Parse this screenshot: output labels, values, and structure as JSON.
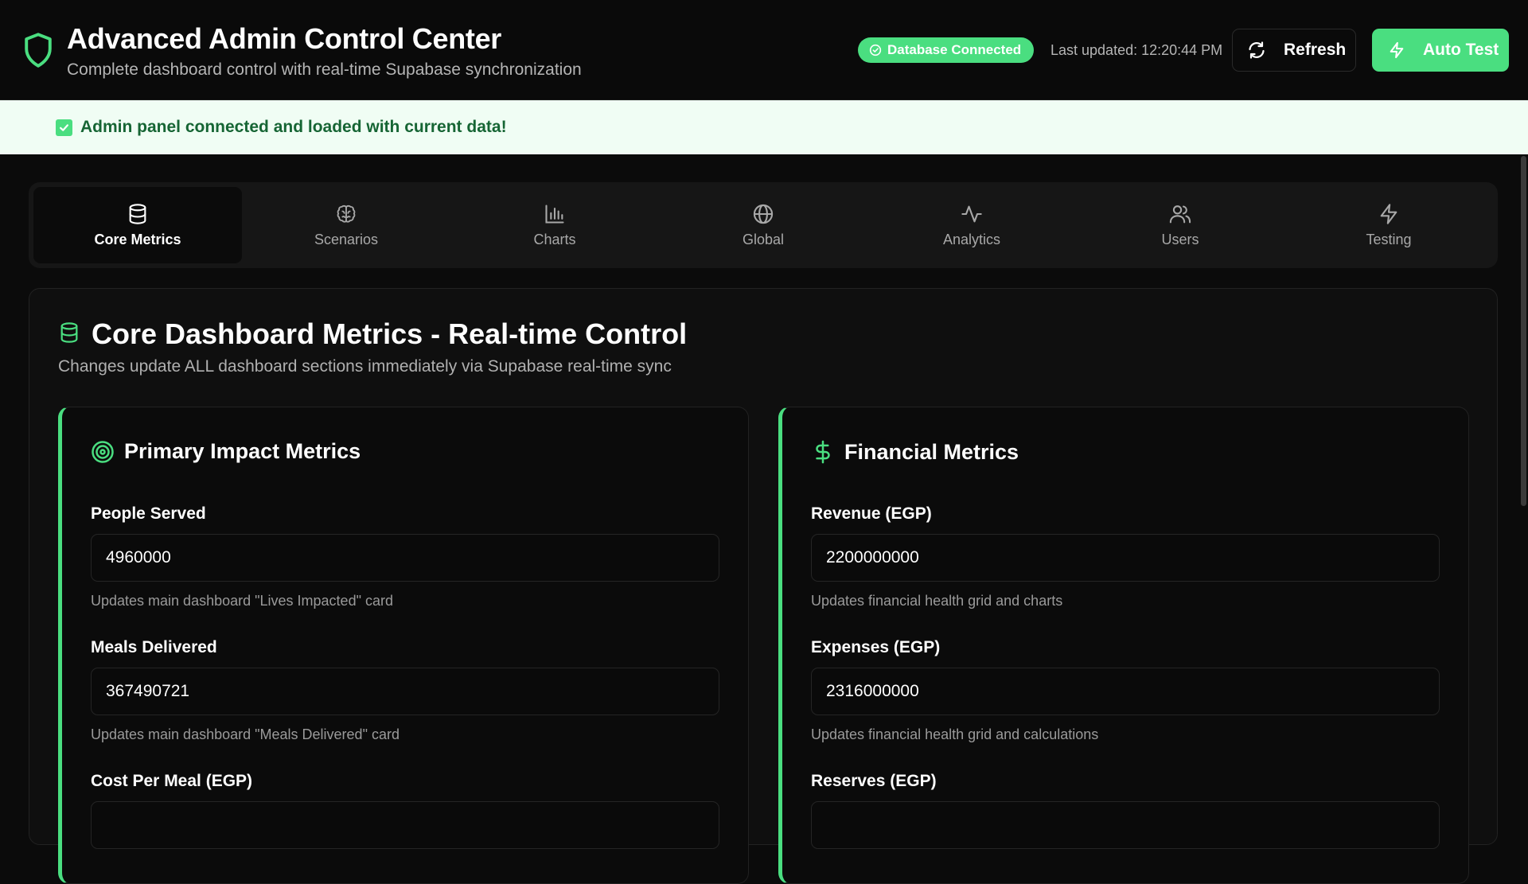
{
  "header": {
    "title": "Advanced Admin Control Center",
    "subtitle": "Complete dashboard control with real-time Supabase synchronization",
    "db_status": "Database Connected",
    "last_updated": "Last updated: 12:20:44 PM",
    "refresh_label": "Refresh",
    "autotest_label": "Auto Test",
    "brand_icon": "shield-icon"
  },
  "notice": {
    "text": "Admin panel connected and loaded with current data!",
    "icon": "check-square-icon"
  },
  "tabs": [
    {
      "label": "Core Metrics",
      "icon": "database-icon",
      "active": true
    },
    {
      "label": "Scenarios",
      "icon": "brain-icon",
      "active": false
    },
    {
      "label": "Charts",
      "icon": "bar-chart-icon",
      "active": false
    },
    {
      "label": "Global",
      "icon": "globe-icon",
      "active": false
    },
    {
      "label": "Analytics",
      "icon": "activity-icon",
      "active": false
    },
    {
      "label": "Users",
      "icon": "users-icon",
      "active": false
    },
    {
      "label": "Testing",
      "icon": "zap-icon",
      "active": false
    }
  ],
  "panel": {
    "title": "Core Dashboard Metrics - Real-time Control",
    "subtitle": "Changes update ALL dashboard sections immediately via Supabase real-time sync"
  },
  "primary": {
    "title": "Primary Impact Metrics",
    "icon": "target-icon",
    "fields": [
      {
        "label": "People Served",
        "value": "4960000",
        "help": "Updates main dashboard \"Lives Impacted\" card"
      },
      {
        "label": "Meals Delivered",
        "value": "367490721",
        "help": "Updates main dashboard \"Meals Delivered\" card"
      },
      {
        "label": "Cost Per Meal (EGP)",
        "value": "",
        "help": ""
      }
    ]
  },
  "financial": {
    "title": "Financial Metrics",
    "icon": "dollar-icon",
    "fields": [
      {
        "label": "Revenue (EGP)",
        "value": "2200000000",
        "help": "Updates financial health grid and charts"
      },
      {
        "label": "Expenses (EGP)",
        "value": "2316000000",
        "help": "Updates financial health grid and calculations"
      },
      {
        "label": "Reserves (EGP)",
        "value": "",
        "help": ""
      }
    ]
  },
  "colors": {
    "accent": "#4ade80",
    "background": "#0b0b0b",
    "notice_bg": "#f0fdf4",
    "notice_text": "#166534"
  }
}
